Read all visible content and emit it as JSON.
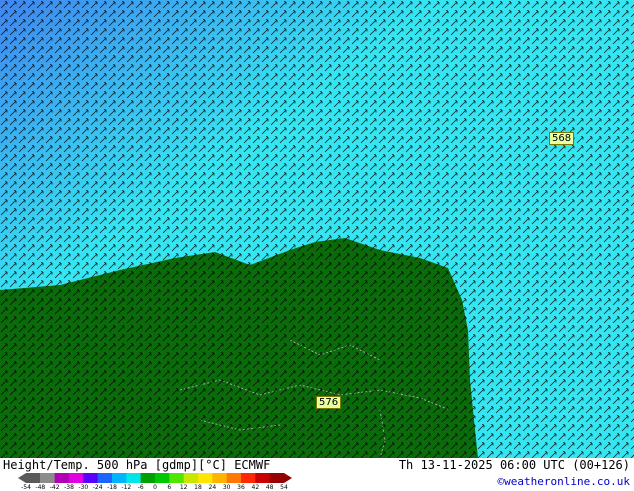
{
  "map": {
    "land_color": "#0b6b0b",
    "sea_cold_color": "#3f86ef",
    "sea_warm_color": "#35e6f2",
    "barb_color": "#000000",
    "contour_labels": [
      {
        "text": "568",
        "name": "contour-label-568"
      },
      {
        "text": "576",
        "name": "contour-label-576"
      }
    ]
  },
  "footer": {
    "title": "Height/Temp. 500 hPa [gdmp][°C] ECMWF",
    "valid_time": "Th 13-11-2025 06:00 UTC (00+126)",
    "credit": "©weatheronline.co.uk",
    "colorbar": {
      "ticks": [
        "-54",
        "-48",
        "-42",
        "-38",
        "-30",
        "-24",
        "-18",
        "-12",
        "-6",
        "0",
        "6",
        "12",
        "18",
        "24",
        "30",
        "36",
        "42",
        "48",
        "54"
      ],
      "colors": [
        "#5a5a5a",
        "#8c8c8c",
        "#b400b4",
        "#e000e0",
        "#5a00ff",
        "#1e64ff",
        "#00b4ff",
        "#00e6e6",
        "#00a000",
        "#00c800",
        "#50e600",
        "#c8e600",
        "#ffe600",
        "#ffb400",
        "#ff7800",
        "#ff2800",
        "#c80000",
        "#960000"
      ]
    }
  }
}
